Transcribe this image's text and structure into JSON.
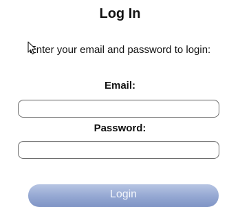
{
  "page": {
    "title": "Log In",
    "instructions": "Enter your email and password to login:"
  },
  "form": {
    "email_label": "Email:",
    "email_value": "",
    "password_label": "Password:",
    "password_value": "",
    "submit_label": "Login"
  },
  "cursor": {
    "icon": "mouse-pointer-icon"
  },
  "colors": {
    "button_top": "#b7c5e3",
    "button_bottom": "#7f94c5",
    "button_text": "#f2f5fb",
    "field_border": "#6e6e6e"
  }
}
